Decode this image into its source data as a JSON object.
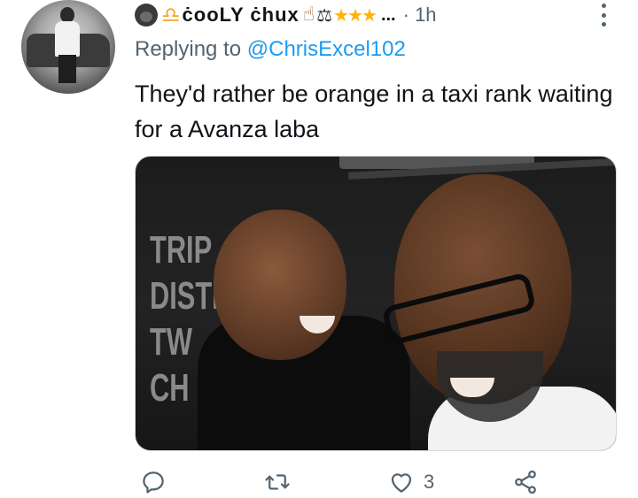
{
  "author": {
    "display_name": "ċooLY ċhux",
    "timestamp": "1h",
    "separator": "·",
    "ellipsis": "..."
  },
  "reply": {
    "prefix": "Replying to",
    "handle": "@ChrisExcel102"
  },
  "tweet": {
    "text": "They'd rather be orange in a taxi rank waiting for a Avanza laba"
  },
  "photo": {
    "wall_text": "TRIP\nDISTI\nTW\nCH"
  },
  "actions": {
    "reply_icon": "reply-icon",
    "retweet_icon": "retweet-icon",
    "like_icon": "heart-icon",
    "like_count": "3",
    "share_icon": "share-icon"
  },
  "colors": {
    "accent": "#1d9bf0",
    "secondary_text": "#536471",
    "primary_text": "#0f1419"
  }
}
